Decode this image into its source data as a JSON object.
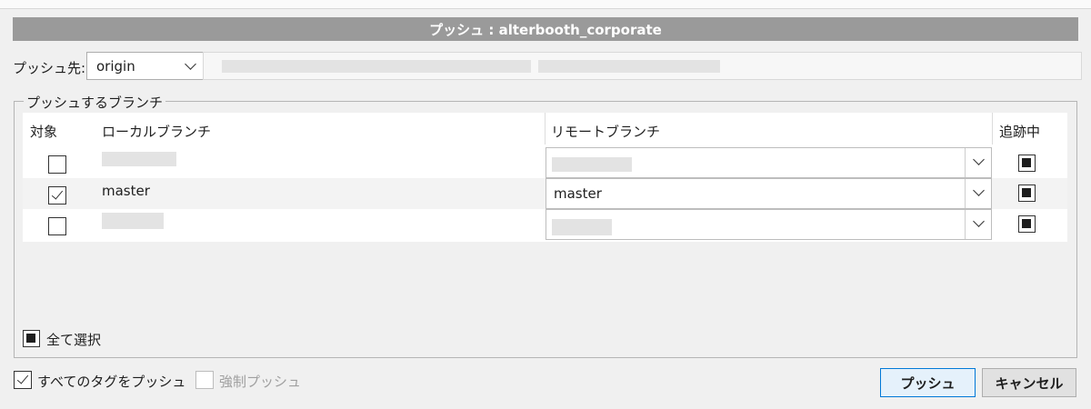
{
  "dialog": {
    "title": "プッシュ : alterbooth_corporate"
  },
  "remote": {
    "label": "プッシュ先:",
    "selected": "origin"
  },
  "branches": {
    "group_title": "プッシュするブランチ",
    "columns": {
      "target": "対象",
      "local": "ローカルブランチ",
      "remote": "リモートブランチ",
      "tracking": "追跡中"
    },
    "rows": [
      {
        "checked": false,
        "local": "",
        "remote": "",
        "tracking": true
      },
      {
        "checked": true,
        "local": "master",
        "remote": "master",
        "tracking": true
      },
      {
        "checked": false,
        "local": "",
        "remote": "",
        "tracking": true
      }
    ],
    "select_all_label": "全て選択",
    "select_all_state": "indeterminate"
  },
  "options": {
    "push_all_tags": {
      "label": "すべてのタグをプッシュ",
      "checked": true
    },
    "force_push": {
      "label": "強制プッシュ",
      "checked": false,
      "enabled": false
    }
  },
  "buttons": {
    "push": "プッシュ",
    "cancel": "キャンセル"
  }
}
